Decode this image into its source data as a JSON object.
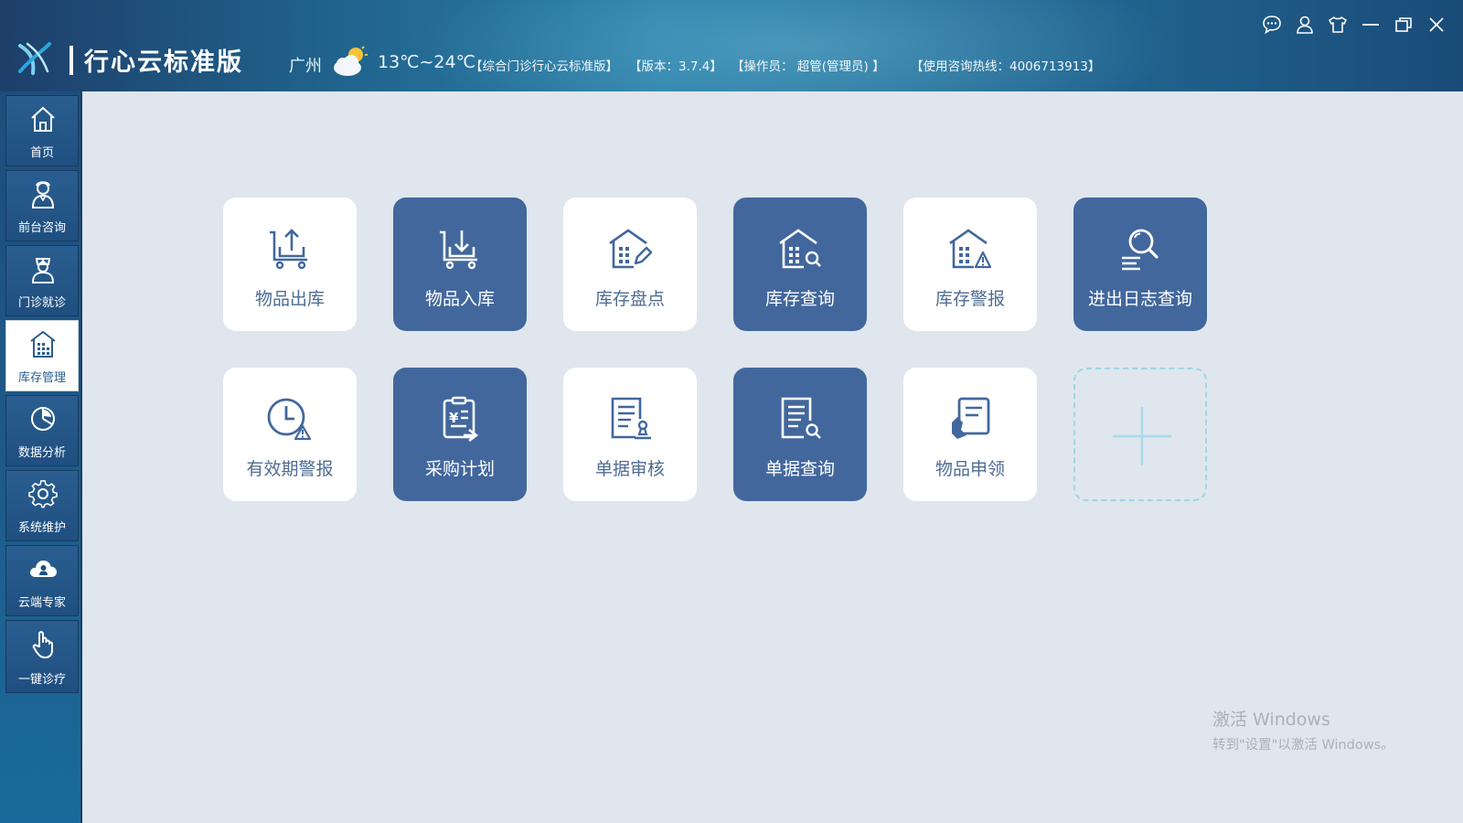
{
  "header": {
    "app_title": "行心云标准版",
    "city": "广州",
    "temperature": "13℃~24℃",
    "edition": "【综合门诊行心云标准版】",
    "version": "【版本：3.7.4】",
    "operator": "【操作员： 超管(管理员) 】",
    "hotline": "【使用咨询热线：4006713913】",
    "weather_icon": "partly-cloudy-icon",
    "logo_icon": "xinxin-logo-icon"
  },
  "window_controls": [
    "chat-icon",
    "user-icon",
    "skin-icon",
    "minimize-icon",
    "restore-icon",
    "close-icon"
  ],
  "sidebar": {
    "items": [
      {
        "label": "首页",
        "icon": "home-icon",
        "active": false
      },
      {
        "label": "前台咨询",
        "icon": "receptionist-icon",
        "active": false
      },
      {
        "label": "门诊就诊",
        "icon": "doctor-icon",
        "active": false
      },
      {
        "label": "库存管理",
        "icon": "warehouse-icon",
        "active": true
      },
      {
        "label": "数据分析",
        "icon": "pie-chart-icon",
        "active": false
      },
      {
        "label": "系统维护",
        "icon": "gear-icon",
        "active": false
      },
      {
        "label": "云端专家",
        "icon": "cloud-expert-icon",
        "active": false
      },
      {
        "label": "一键诊疗",
        "icon": "tap-hand-icon",
        "active": false
      }
    ]
  },
  "tiles": [
    {
      "label": "物品出库",
      "icon": "cart-out-icon",
      "style": "light"
    },
    {
      "label": "物品入库",
      "icon": "cart-in-icon",
      "style": "dark"
    },
    {
      "label": "库存盘点",
      "icon": "house-edit-icon",
      "style": "light"
    },
    {
      "label": "库存查询",
      "icon": "house-search-icon",
      "style": "dark"
    },
    {
      "label": "库存警报",
      "icon": "house-warning-icon",
      "style": "light"
    },
    {
      "label": "进出日志查询",
      "icon": "log-search-icon",
      "style": "dark"
    },
    {
      "label": "有效期警报",
      "icon": "clock-warning-icon",
      "style": "light"
    },
    {
      "label": "采购计划",
      "icon": "purchase-plan-icon",
      "style": "dark"
    },
    {
      "label": "单据审核",
      "icon": "document-approve-icon",
      "style": "light"
    },
    {
      "label": "单据查询",
      "icon": "document-search-icon",
      "style": "dark"
    },
    {
      "label": "物品申领",
      "icon": "item-request-icon",
      "style": "light"
    }
  ],
  "add_tile_icon": "plus-icon",
  "watermark": {
    "line1": "激活 Windows",
    "line2": "转到\"设置\"以激活 Windows。"
  }
}
